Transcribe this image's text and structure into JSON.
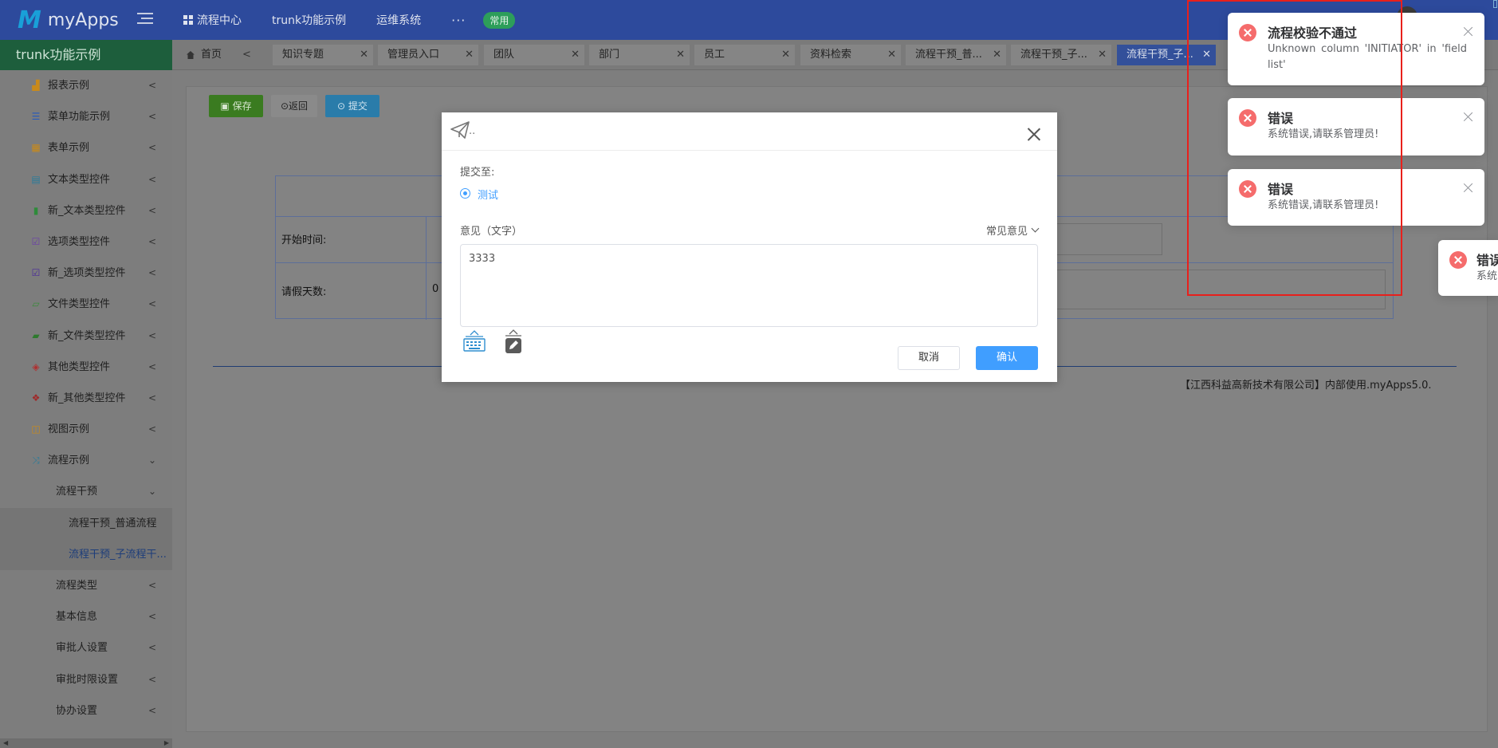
{
  "app": {
    "logo_mark": "M",
    "name": "myApps"
  },
  "top_nav": {
    "items": [
      {
        "label": "流程中心",
        "icon": "grid-icon"
      },
      {
        "label": "trunk功能示例"
      },
      {
        "label": "运维系统"
      }
    ],
    "more": "···",
    "badge": "常用"
  },
  "sidebar": {
    "title": "trunk功能示例",
    "items": [
      {
        "label": "报表示例",
        "icon": "chart-icon",
        "icon_color": "#c98a1a"
      },
      {
        "label": "菜单功能示例",
        "icon": "list-icon",
        "icon_color": "#2b5bb8"
      },
      {
        "label": "表单示例",
        "icon": "table-icon",
        "icon_color": "#c98a1a"
      },
      {
        "label": "文本类型控件",
        "icon": "document-icon",
        "icon_color": "#2a7b9a"
      },
      {
        "label": "新_文本类型控件",
        "icon": "document-filled-icon",
        "icon_color": "#2e8b3a"
      },
      {
        "label": "选项类型控件",
        "icon": "checkbox-icon",
        "icon_color": "#6a3ea8"
      },
      {
        "label": "新_选项类型控件",
        "icon": "checkbox-filled-icon",
        "icon_color": "#4a2a9a"
      },
      {
        "label": "文件类型控件",
        "icon": "folder-open-icon",
        "icon_color": "#3a8a3a"
      },
      {
        "label": "新_文件类型控件",
        "icon": "folder-filled-icon",
        "icon_color": "#2e7a2e"
      },
      {
        "label": "其他类型控件",
        "icon": "cube-icon",
        "icon_color": "#b03030"
      },
      {
        "label": "新_其他类型控件",
        "icon": "cubes-icon",
        "icon_color": "#a02828"
      },
      {
        "label": "视图示例",
        "icon": "columns-icon",
        "icon_color": "#c98a1a"
      },
      {
        "label": "流程示例",
        "icon": "shuffle-icon",
        "icon_color": "#2a7b9a"
      }
    ],
    "sub_group": {
      "label": "流程干预"
    },
    "sub_items": [
      {
        "label": "流程干预_普通流程"
      },
      {
        "label": "流程干预_子流程干..."
      }
    ],
    "more_items": [
      {
        "label": "流程类型"
      },
      {
        "label": "基本信息"
      },
      {
        "label": "审批人设置"
      },
      {
        "label": "审批时限设置"
      },
      {
        "label": "协办设置"
      }
    ]
  },
  "tabs": {
    "home": "首页",
    "items": [
      {
        "label": "知识专题"
      },
      {
        "label": "管理员入口"
      },
      {
        "label": "团队"
      },
      {
        "label": "部门"
      },
      {
        "label": "员工"
      },
      {
        "label": "资料检索"
      },
      {
        "label": "流程干预_普..."
      },
      {
        "label": "流程干预_子..."
      },
      {
        "label": "流程干预_子..."
      }
    ]
  },
  "toolbar": {
    "save": "保存",
    "back": "返回",
    "submit": "提交"
  },
  "form": {
    "start_time_label": "开始时间:",
    "leave_days_label": "请假天数:",
    "leave_days_value": "0"
  },
  "footer": {
    "text": "【江西科益高新技术有限公司】内部使用.myApps5.0."
  },
  "modal": {
    "title_suffix": "..",
    "submit_to_label": "提交至:",
    "option_label": "测试",
    "opinion_label": "意见（文字）",
    "common_opinion": "常见意见",
    "opinion_value": "3333",
    "cancel": "取消",
    "confirm": "确认"
  },
  "notifications": [
    {
      "title": "流程校验不通过",
      "message": "Unknown column 'INITIATOR' in 'field list'"
    },
    {
      "title": "错误",
      "message": "系统错误,请联系管理员!"
    },
    {
      "title": "错误",
      "message": "系统错误,请联系管理员!"
    },
    {
      "title": "错误",
      "message": "系统"
    }
  ],
  "colors": {
    "topbar": "#2d4a9c",
    "sidebar_header": "#1d5e3c",
    "primary": "#409eff",
    "error": "#f56c6c",
    "highlight": "#e8201c"
  }
}
